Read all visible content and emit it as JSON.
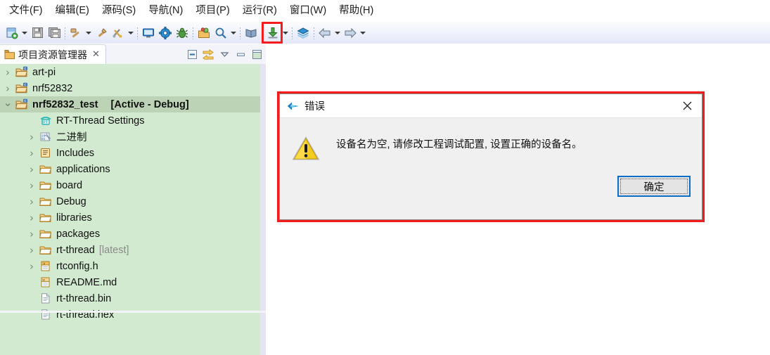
{
  "menubar": {
    "items": [
      {
        "label": "文件(F)",
        "name": "menu-file"
      },
      {
        "label": "编辑(E)",
        "name": "menu-edit"
      },
      {
        "label": "源码(S)",
        "name": "menu-source"
      },
      {
        "label": "导航(N)",
        "name": "menu-navigate"
      },
      {
        "label": "项目(P)",
        "name": "menu-project"
      },
      {
        "label": "运行(R)",
        "name": "menu-run"
      },
      {
        "label": "窗口(W)",
        "name": "menu-window"
      },
      {
        "label": "帮助(H)",
        "name": "menu-help"
      }
    ]
  },
  "toolbar": {
    "highlight_color": "#f31b1b",
    "buttons": [
      {
        "icon": "new-file-icon",
        "dropdown": true
      },
      {
        "icon": "save-icon",
        "dropdown": false
      },
      {
        "icon": "save-all-icon",
        "dropdown": false
      },
      {
        "sep": true
      },
      {
        "icon": "build-hammer-icon",
        "dropdown": true
      },
      {
        "icon": "clean-icon",
        "dropdown": false
      },
      {
        "icon": "build-tools-icon",
        "dropdown": true
      },
      {
        "sep": true
      },
      {
        "icon": "terminal-icon",
        "dropdown": false
      },
      {
        "icon": "settings-gear-icon",
        "dropdown": false
      },
      {
        "icon": "debug-bug-icon",
        "dropdown": false
      },
      {
        "sep": true
      },
      {
        "icon": "package-icon",
        "dropdown": false
      },
      {
        "icon": "search-icon",
        "dropdown": true
      },
      {
        "sep": true
      },
      {
        "icon": "book-icon",
        "dropdown": false
      },
      {
        "sep": true
      },
      {
        "icon": "download-flash-icon",
        "dropdown": true,
        "highlighted": true
      },
      {
        "sep": true
      },
      {
        "icon": "layers-icon",
        "dropdown": false
      },
      {
        "sep": true
      },
      {
        "icon": "back-arrow-icon",
        "dropdown": true
      },
      {
        "icon": "forward-arrow-icon",
        "dropdown": true
      }
    ]
  },
  "explorer": {
    "tab_label": "项目资源管理器",
    "tab_icon": "project-explorer-icon",
    "tab_close": "✕",
    "tools": [
      {
        "name": "collapse-all-icon"
      },
      {
        "name": "link-with-editor-icon"
      },
      {
        "name": "view-menu-icon"
      },
      {
        "name": "minimize-view-icon"
      },
      {
        "name": "maximize-view-icon"
      }
    ],
    "tree": [
      {
        "label": "art-pi",
        "icon": "c-project-folder-icon",
        "twisty": "right",
        "indent": 0,
        "selected": false,
        "bold": false
      },
      {
        "label": "nrf52832",
        "icon": "c-project-folder-icon",
        "twisty": "right",
        "indent": 0,
        "selected": false,
        "bold": false
      },
      {
        "label": "nrf52832_test",
        "suffix": "[Active - Debug]",
        "icon": "c-project-folder-icon",
        "twisty": "down",
        "indent": 0,
        "selected": true,
        "bold": true
      },
      {
        "label": "RT-Thread Settings",
        "icon": "rt-thread-settings-icon",
        "twisty": "none",
        "indent": 1,
        "selected": false,
        "bold": false
      },
      {
        "label": "二进制",
        "icon": "binaries-icon",
        "twisty": "right",
        "indent": 1,
        "selected": false,
        "bold": false
      },
      {
        "label": "Includes",
        "icon": "includes-icon",
        "twisty": "right",
        "indent": 1,
        "selected": false,
        "bold": false
      },
      {
        "label": "applications",
        "icon": "folder-icon",
        "twisty": "right",
        "indent": 1,
        "selected": false,
        "bold": false
      },
      {
        "label": "board",
        "icon": "folder-icon",
        "twisty": "right",
        "indent": 1,
        "selected": false,
        "bold": false
      },
      {
        "label": "Debug",
        "icon": "folder-icon",
        "twisty": "right",
        "indent": 1,
        "selected": false,
        "bold": false
      },
      {
        "label": "libraries",
        "icon": "folder-icon",
        "twisty": "right",
        "indent": 1,
        "selected": false,
        "bold": false
      },
      {
        "label": "packages",
        "icon": "folder-icon",
        "twisty": "right",
        "indent": 1,
        "selected": false,
        "bold": false
      },
      {
        "label": "rt-thread",
        "suffix_muted": "[latest]",
        "icon": "folder-icon",
        "twisty": "right",
        "indent": 1,
        "selected": false,
        "bold": false
      },
      {
        "label": "rtconfig.h",
        "icon": "header-file-icon",
        "twisty": "right",
        "indent": 1,
        "selected": false,
        "bold": false
      },
      {
        "label": "README.md",
        "icon": "markdown-file-icon",
        "twisty": "none",
        "indent": 1,
        "selected": false,
        "bold": false
      },
      {
        "label": "rt-thread.bin",
        "icon": "binary-file-icon",
        "twisty": "none",
        "indent": 1,
        "selected": false,
        "bold": false
      },
      {
        "label": "rt-thread.hex",
        "icon": "binary-file-icon",
        "twisty": "none",
        "indent": 1,
        "selected": false,
        "bold": false
      }
    ],
    "background_color": "#d2ead0",
    "selection_color": "#bcd3b6"
  },
  "dialog": {
    "title": "错误",
    "title_icon": "rt-thread-logo-icon",
    "close_label": "✕",
    "warning_icon": "warning-triangle-icon",
    "message": "设备名为空, 请修改工程调试配置, 设置正确的设备名。",
    "ok_label": "确定",
    "outline_color": "#f31b1b",
    "focus_color": "#0a6ec4"
  }
}
